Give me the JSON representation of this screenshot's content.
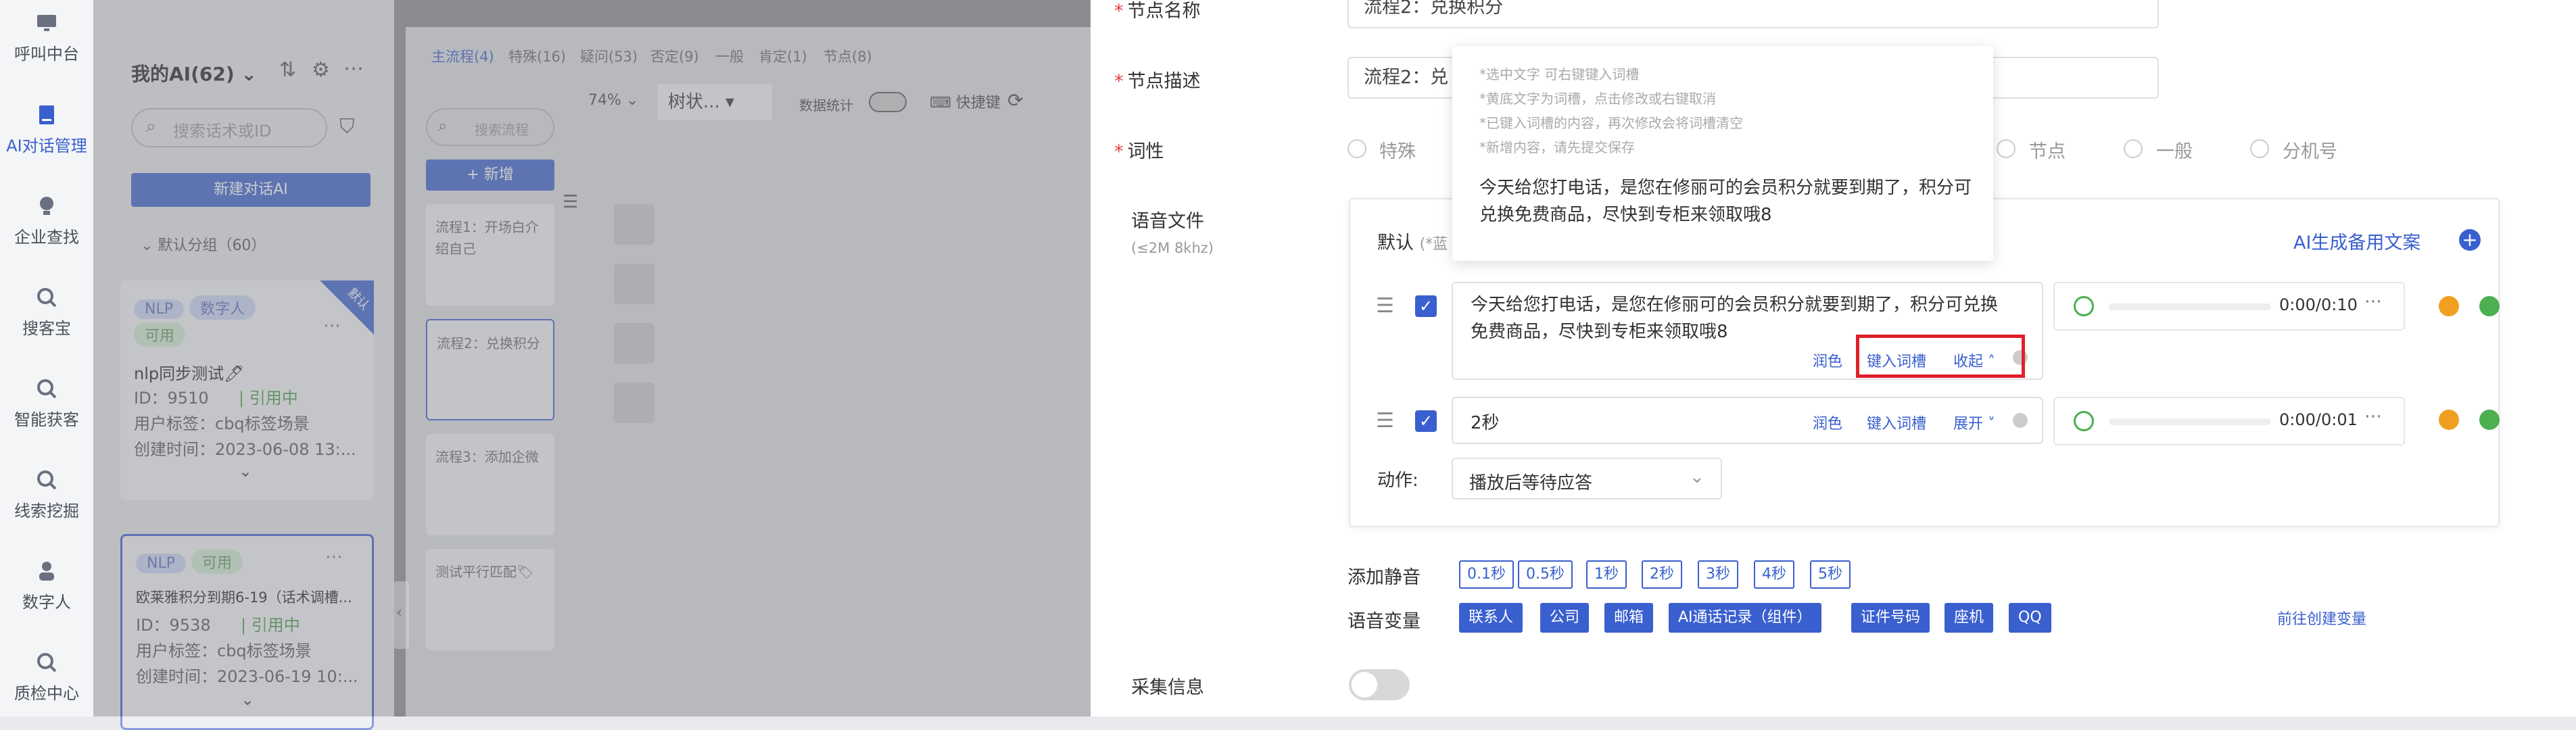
{
  "nav": {
    "items": [
      {
        "label": "呼叫中台"
      },
      {
        "label": "AI对话管理"
      },
      {
        "label": "企业查找"
      },
      {
        "label": "搜客宝"
      },
      {
        "label": "智能获客"
      },
      {
        "label": "线索挖掘"
      },
      {
        "label": "数字人"
      },
      {
        "label": "质检中心"
      }
    ]
  },
  "list_panel": {
    "title": "我的AI(62)",
    "search_placeholder": "搜索话术或ID",
    "new_button": "新建对话AI",
    "group_label": "默认分组（60）",
    "cards": [
      {
        "tags": [
          "NLP",
          "数字人",
          "可用"
        ],
        "corner": "默认",
        "name": "nlp同步测试🖊",
        "id_label": "ID：9510",
        "status": "引用中",
        "user_tag": "用户标签：cbq标签场景",
        "created": "创建时间：2023-06-08 13:..."
      },
      {
        "tags": [
          "NLP",
          "可用"
        ],
        "name": "欧莱雅积分到期6-19（话术调槽...",
        "id_label": "ID：9538",
        "status": "引用中",
        "user_tag": "用户标签：cbq标签场景",
        "created": "创建时间：2023-06-19 10:..."
      }
    ]
  },
  "flow_panel": {
    "tabs": [
      "主流程(4)",
      "特殊(16)",
      "疑问(53)",
      "否定(9)",
      "一般",
      "肯定(1)",
      "节点(8)"
    ],
    "search_placeholder": "搜索流程",
    "add_button": "+ 新增",
    "zoom": "74%",
    "view_mode": "树状...",
    "data_stats_label": "数据统计",
    "shortcut_label": "快捷键",
    "nodes": [
      {
        "label": "流程1：开场白介绍自己"
      },
      {
        "label": "流程2：兑换积分"
      },
      {
        "label": "流程3：添加企微"
      },
      {
        "label": "测试平行匹配🏷"
      }
    ]
  },
  "editor": {
    "node_name_label": "节点名称",
    "node_name_value": "流程2：兑换积分",
    "node_desc_label": "节点描述",
    "node_desc_value": "流程2：兑",
    "pos_label": "词性",
    "pos_options": [
      "特殊",
      "节点",
      "一般",
      "分机号"
    ],
    "voice_file_label": "语音文件",
    "voice_file_hint": "(≤2M 8khz)",
    "default_label": "默认",
    "default_hint": "(*蓝",
    "ai_backup": "AI生成备用文案",
    "tooltip": {
      "hints": [
        "*选中文字 可右键键入词槽",
        "*黄底文字为词槽，点击修改或右键取消",
        "*已键入词槽的内容，再次修改会将词槽清空",
        "*新增内容，请先提交保存"
      ],
      "preview": "今天给您打电话，是您在修丽可的会员积分就要到期了，积分可兑换免费商品，尽快到专柜来领取哦8"
    },
    "segments": [
      {
        "text": "今天给您打电话，是您在修丽可的会员积分就要到期了，积分可兑换免费商品，尽快到专柜来领取哦8",
        "polish": "润色",
        "slot": "键入词槽",
        "toggle": "收起",
        "time": "0:00/0:10"
      },
      {
        "text": "2秒",
        "polish": "润色",
        "slot": "键入词槽",
        "toggle": "展开",
        "time": "0:00/0:01"
      }
    ],
    "action_label": "动作:",
    "action_value": "播放后等待应答",
    "silence_label": "添加静音",
    "silence_options": [
      "0.1秒",
      "0.5秒",
      "1秒",
      "2秒",
      "3秒",
      "4秒",
      "5秒"
    ],
    "variable_label": "语音变量",
    "variables": [
      "联系人",
      "公司",
      "邮箱",
      "AI通话记录（组件）",
      "证件号码",
      "座机",
      "QQ"
    ],
    "create_variable": "前往创建变量",
    "collect_label": "采集信息"
  },
  "colors": {
    "accent": "#3a5fcf",
    "required": "#e04040",
    "highlight_box": "#e0202a",
    "play_green": "#4caf50",
    "minus_orange": "#f0a020"
  }
}
